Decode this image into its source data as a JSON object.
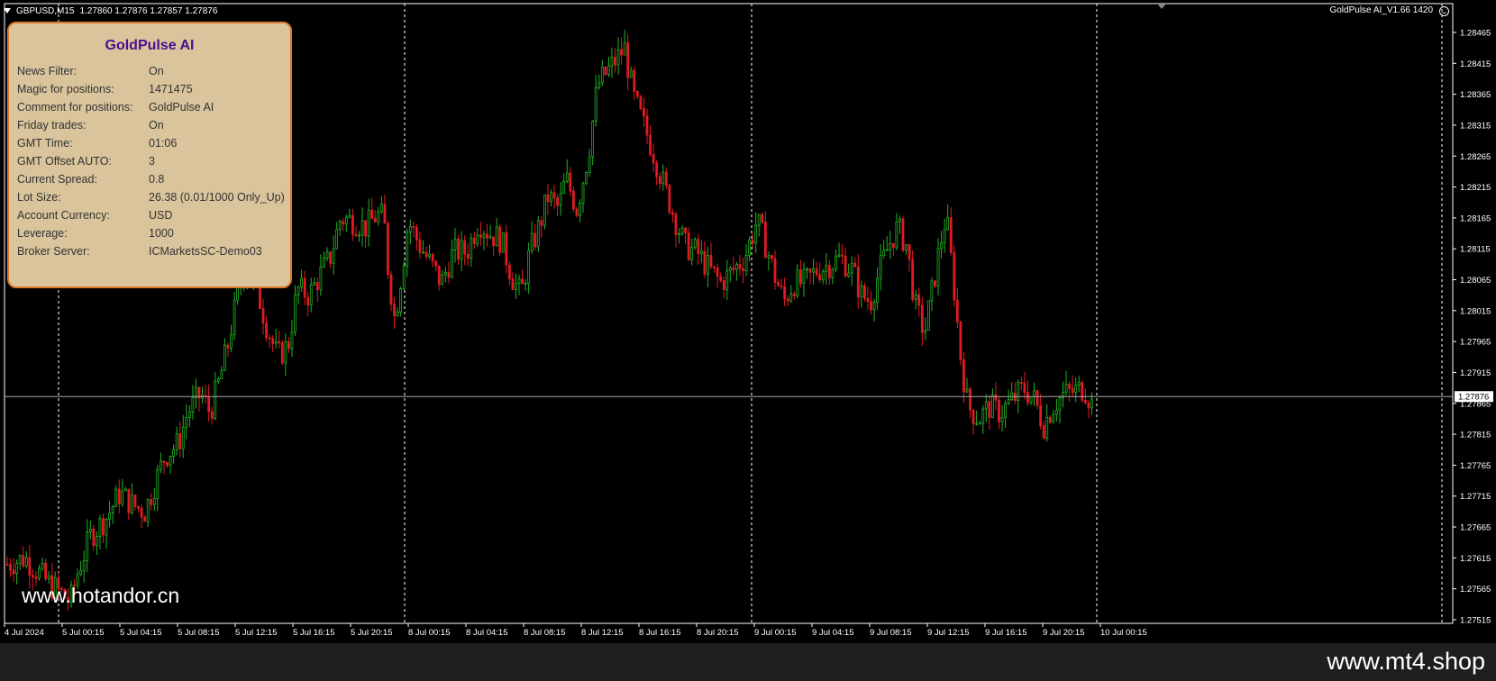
{
  "chart": {
    "symbol_label": "GBPUSD,M15",
    "ohlc": "1.27860 1.27876 1.27857 1.27876",
    "ea_label": "GoldPulse AI_V1.66 1420",
    "current_price": "1.27876",
    "price_labels": [
      "1.28465",
      "1.28415",
      "1.28365",
      "1.28315",
      "1.28265",
      "1.28215",
      "1.28165",
      "1.28115",
      "1.28065",
      "1.28015",
      "1.27965",
      "1.27915",
      "1.27865",
      "1.27815",
      "1.27765",
      "1.27715",
      "1.27665",
      "1.27615",
      "1.27565",
      "1.27515"
    ],
    "time_labels": [
      "4 Jul 2024",
      "5 Jul 00:15",
      "5 Jul 04:15",
      "5 Jul 08:15",
      "5 Jul 12:15",
      "5 Jul 16:15",
      "5 Jul 20:15",
      "8 Jul 00:15",
      "8 Jul 04:15",
      "8 Jul 08:15",
      "8 Jul 12:15",
      "8 Jul 16:15",
      "8 Jul 20:15",
      "9 Jul 00:15",
      "9 Jul 04:15",
      "9 Jul 08:15",
      "9 Jul 12:15",
      "9 Jul 16:15",
      "9 Jul 20:15",
      "10 Jul 00:15"
    ],
    "colors": {
      "bull": "#21b324",
      "bear": "#e01b22",
      "bg": "#000000",
      "text": "#ffffff",
      "grid": "#ffffff"
    },
    "price_path": [
      [
        0,
        1.27605
      ],
      [
        20,
        1.27615
      ],
      [
        45,
        1.27575
      ],
      [
        58,
        1.2756
      ],
      [
        70,
        1.27545
      ],
      [
        78,
        1.2759
      ],
      [
        92,
        1.2765
      ],
      [
        110,
        1.2768
      ],
      [
        125,
        1.2772
      ],
      [
        140,
        1.277
      ],
      [
        153,
        1.2769
      ],
      [
        160,
        1.2772
      ],
      [
        175,
        1.2778
      ],
      [
        190,
        1.278
      ],
      [
        200,
        1.2785
      ],
      [
        215,
        1.2788
      ],
      [
        225,
        1.2785
      ],
      [
        235,
        1.279
      ],
      [
        245,
        1.2796
      ],
      [
        250,
        1.28
      ],
      [
        262,
        1.2808
      ],
      [
        275,
        1.2806
      ],
      [
        288,
        1.2799
      ],
      [
        300,
        1.2794
      ],
      [
        312,
        1.2796
      ],
      [
        322,
        1.2805
      ],
      [
        335,
        1.2804
      ],
      [
        350,
        1.2808
      ],
      [
        358,
        1.281
      ],
      [
        370,
        1.28165
      ],
      [
        385,
        1.2816
      ],
      [
        398,
        1.2815
      ],
      [
        410,
        1.2817
      ],
      [
        418,
        1.28165
      ],
      [
        422,
        1.2809
      ],
      [
        430,
        1.28
      ],
      [
        438,
        1.2808
      ],
      [
        445,
        1.2816
      ],
      [
        458,
        1.2812
      ],
      [
        470,
        1.2809
      ],
      [
        482,
        1.2806
      ],
      [
        495,
        1.2811
      ],
      [
        510,
        1.2811
      ],
      [
        523,
        1.2816
      ],
      [
        535,
        1.2814
      ],
      [
        548,
        1.2813
      ],
      [
        560,
        1.2807
      ],
      [
        570,
        1.2804
      ],
      [
        580,
        1.2811
      ],
      [
        590,
        1.2815
      ],
      [
        600,
        1.282
      ],
      [
        612,
        1.2818
      ],
      [
        620,
        1.2823
      ],
      [
        632,
        1.2818
      ],
      [
        645,
        1.2827
      ],
      [
        655,
        1.2838
      ],
      [
        665,
        1.284
      ],
      [
        675,
        1.2842
      ],
      [
        685,
        1.2844
      ],
      [
        695,
        1.2836
      ],
      [
        705,
        1.2832
      ],
      [
        715,
        1.2828
      ],
      [
        728,
        1.2822
      ],
      [
        742,
        1.2816
      ],
      [
        752,
        1.2812
      ],
      [
        765,
        1.2811
      ],
      [
        780,
        1.2808
      ],
      [
        792,
        1.2806
      ],
      [
        805,
        1.2808
      ],
      [
        818,
        1.281
      ],
      [
        832,
        1.2816
      ],
      [
        842,
        1.2812
      ],
      [
        852,
        1.2807
      ],
      [
        862,
        1.2803
      ],
      [
        872,
        1.2806
      ],
      [
        885,
        1.2806
      ],
      [
        898,
        1.2808
      ],
      [
        912,
        1.2809
      ],
      [
        925,
        1.281
      ],
      [
        938,
        1.2808
      ],
      [
        948,
        1.2804
      ],
      [
        958,
        1.2803
      ],
      [
        968,
        1.2808
      ],
      [
        978,
        1.2812
      ],
      [
        988,
        1.2815
      ],
      [
        998,
        1.2812
      ],
      [
        1008,
        1.2802
      ],
      [
        1018,
        1.2798
      ],
      [
        1028,
        1.2806
      ],
      [
        1035,
        1.2812
      ],
      [
        1042,
        1.2817
      ],
      [
        1050,
        1.2806
      ],
      [
        1058,
        1.2794
      ],
      [
        1066,
        1.2786
      ],
      [
        1078,
        1.2784
      ],
      [
        1090,
        1.2786
      ],
      [
        1102,
        1.2785
      ],
      [
        1115,
        1.2787
      ],
      [
        1128,
        1.2789
      ],
      [
        1140,
        1.2787
      ],
      [
        1150,
        1.2783
      ],
      [
        1160,
        1.2786
      ],
      [
        1172,
        1.2788
      ],
      [
        1185,
        1.27885
      ],
      [
        1195,
        1.2789
      ],
      [
        1205,
        1.2786
      ]
    ]
  },
  "panel": {
    "title": "GoldPulse AI",
    "rows": [
      {
        "k": "News Filter:",
        "v": "On"
      },
      {
        "k": "Magic for positions:",
        "v": "1471475"
      },
      {
        "k": "Comment for positions:",
        "v": "GoldPulse AI"
      },
      {
        "k": "Friday trades:",
        "v": "On"
      },
      {
        "k": "GMT Time:",
        "v": "01:06"
      },
      {
        "k": "GMT Offset AUTO:",
        "v": "3"
      },
      {
        "k": "Current Spread:",
        "v": "0.8"
      },
      {
        "k": "Lot Size:",
        "v": "26.38 (0.01/1000 Only_Up)"
      },
      {
        "k": "Account Currency:",
        "v": "USD"
      },
      {
        "k": "Leverage:",
        "v": "1000"
      },
      {
        "k": "Broker Server:",
        "v": "ICMarketsSC-Demo03"
      }
    ],
    "colors": {
      "bg": "#d9c49b",
      "border": "#d87a2c",
      "title": "#4b0f8c"
    }
  },
  "watermarks": {
    "chart": "www.hotandor.cn",
    "footer": "www.mt4.shop"
  }
}
